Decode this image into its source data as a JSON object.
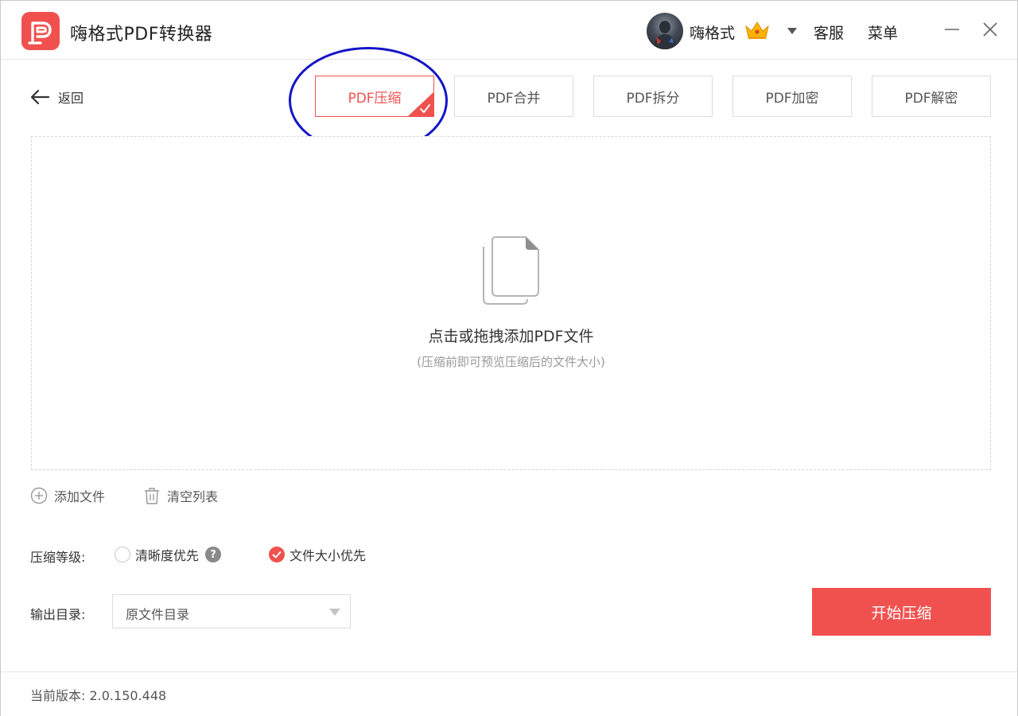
{
  "app": {
    "title": "嗨格式PDF转换器",
    "logo_icon": "pdf-p-logo-icon",
    "accent_color": "#f0514f"
  },
  "header": {
    "username": "嗨格式",
    "vip_icon": "crown-icon",
    "service_label": "客服",
    "menu_label": "菜单",
    "minimize_icon": "minimize-icon",
    "close_icon": "close-icon"
  },
  "toolbar": {
    "back_label": "返回",
    "tabs": [
      {
        "label": "PDF压缩",
        "active": true
      },
      {
        "label": "PDF合并",
        "active": false
      },
      {
        "label": "PDF拆分",
        "active": false
      },
      {
        "label": "PDF加密",
        "active": false
      },
      {
        "label": "PDF解密",
        "active": false
      }
    ]
  },
  "dropzone": {
    "title": "点击或拖拽添加PDF文件",
    "subtitle": "(压缩前即可预览压缩后的文件大小)"
  },
  "file_actions": {
    "add_label": "添加文件",
    "clear_label": "清空列表"
  },
  "compression": {
    "label": "压缩等级:",
    "options": [
      {
        "label": "清晰度优先",
        "selected": false,
        "has_help": true
      },
      {
        "label": "文件大小优先",
        "selected": true,
        "has_help": false
      }
    ]
  },
  "output": {
    "label": "输出目录:",
    "selected": "原文件目录"
  },
  "start_button": "开始压缩",
  "footer": {
    "version": "当前版本: 2.0.150.448"
  },
  "annotation": {
    "color": "#1414c8",
    "target": "PDF压缩"
  }
}
